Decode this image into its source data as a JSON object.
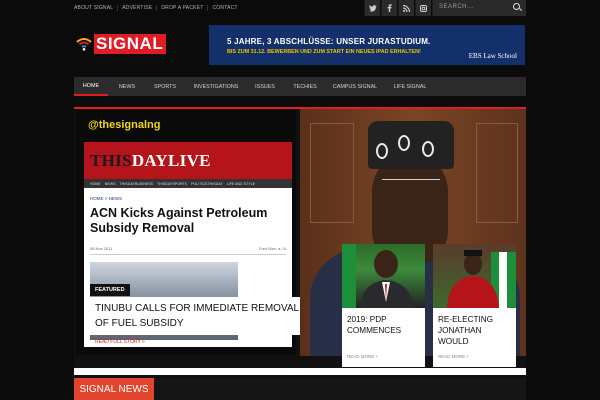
{
  "topbar": {
    "links": [
      "ABOUT SIGNAL",
      "ADVERTISE",
      "DROP A PACKET",
      "CONTACT"
    ],
    "social_icons": [
      "twitter-icon",
      "facebook-icon",
      "rss-icon",
      "instagram-icon"
    ],
    "search_placeholder": "SEARCH..."
  },
  "logo": {
    "text": "SIGNAL",
    "accent": "#e21c23"
  },
  "ad": {
    "line1": "5 JAHRE, 3 ABSCHLÜSSE: UNSER JURASTUDIUM.",
    "line2": "BIS ZUM 31.12. BEWERBEN UND ZUM START EIN NEUES IPAD ERHALTEN!",
    "brand": "EBS Law School",
    "bg": "#13306b"
  },
  "nav": {
    "items": [
      "HOME",
      "NEWS",
      "SPORTS",
      "INVESTIGATIONS",
      "ISSUES",
      "TECHIES",
      "CAMPUS SIGNAL",
      "LIFE SIGNAL"
    ],
    "active": "HOME"
  },
  "hero": {
    "handle": "@thesignalng",
    "screenshot": {
      "masthead_left": "THIS",
      "masthead_right": "DAYLIVE",
      "nav_items": [
        "HOME",
        "NEWS",
        "THISDAYBUSINESS",
        "THISDAYSPORTS",
        "POLITICSTHISDAY",
        "LIFE AND STYLE"
      ],
      "crumb": "HOME > NEWS",
      "headline": "ACN Kicks Against Petroleum Subsidy Removal",
      "date": "08 Nov 2011",
      "font_size": "Font Size: a / A"
    },
    "featured_label": "FEATURED",
    "lead_title": "TINUBU CALLS FOR IMMEDIATE REMOVAL OF FUEL SUBSIDY",
    "read_full": "READ FULL STORY »"
  },
  "cards": [
    {
      "title": "2019: PDP COMMENCES",
      "read_more": "READ MORE +"
    },
    {
      "title": "RE-ELECTING JONATHAN WOULD",
      "read_more": "READ MORE +"
    }
  ],
  "section": {
    "title": "SIGNAL NEWS"
  }
}
